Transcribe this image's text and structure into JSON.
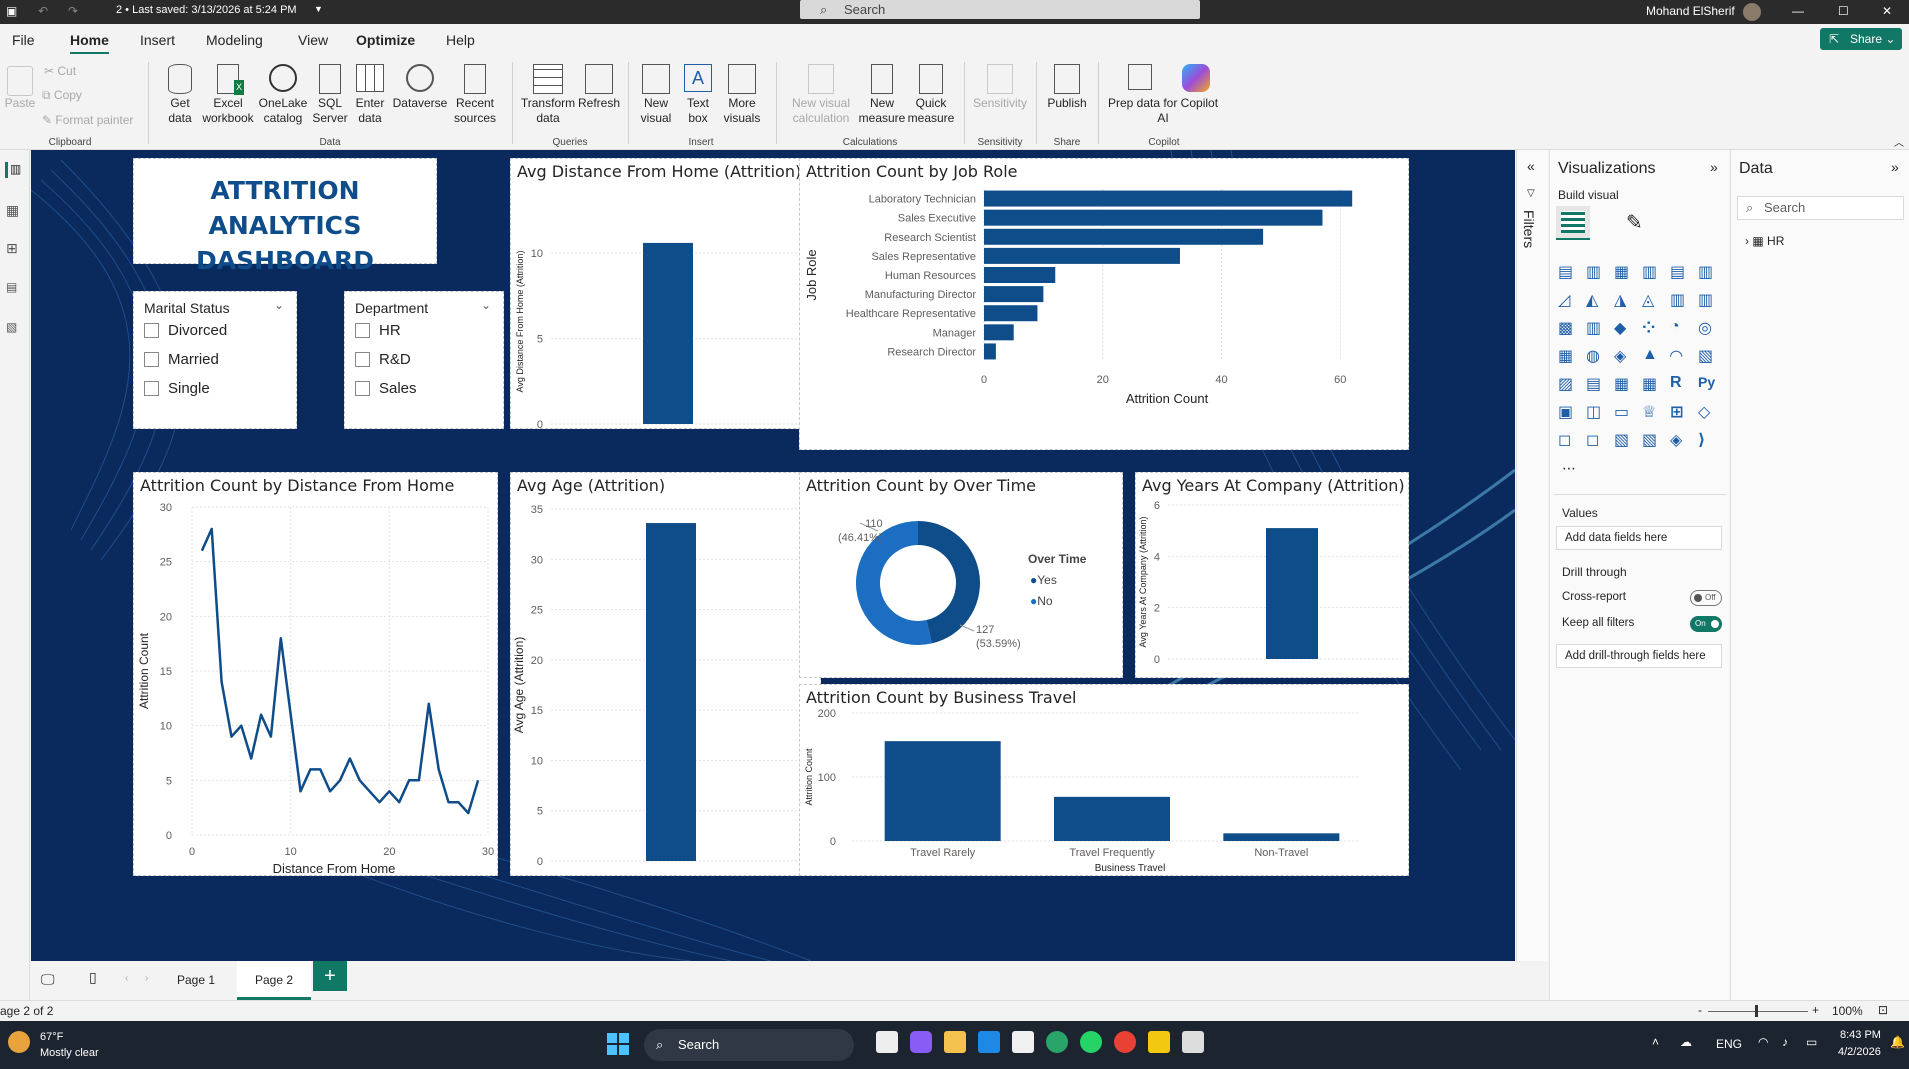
{
  "titlebar": {
    "doc_title": "2 • Last saved: 3/13/2026 at 5:24 PM",
    "search_placeholder": "Search",
    "user_name": "Mohand ElSherif"
  },
  "menu": {
    "file": "File",
    "home": "Home",
    "insert": "Insert",
    "modeling": "Modeling",
    "view": "View",
    "optimize": "Optimize",
    "help": "Help",
    "share": "Share"
  },
  "ribbon": {
    "paste": "Paste",
    "cut": "Cut",
    "copy": "Copy",
    "format_painter": "Format painter",
    "get_data": "Get data",
    "excel": "Excel workbook",
    "onelake": "OneLake catalog",
    "sql": "SQL Server",
    "enter_data": "Enter data",
    "dataverse": "Dataverse",
    "recent": "Recent sources",
    "transform": "Transform data",
    "refresh": "Refresh",
    "new_visual": "New visual",
    "text_box": "Text box",
    "more_visuals": "More visuals",
    "new_visual_calc": "New visual calculation",
    "new_measure": "New measure",
    "quick_measure": "Quick measure",
    "sensitivity": "Sensitivity",
    "publish": "Publish",
    "prep_copilot": "Prep data for Copilot AI",
    "groups": {
      "clipboard": "Clipboard",
      "data": "Data",
      "queries": "Queries",
      "insert": "Insert",
      "calculations": "Calculations",
      "sensitivity": "Sensitivity",
      "share": "Share",
      "copilot": "Copilot"
    }
  },
  "dashboard": {
    "title_line1": "ATTRITION ANALYTICS",
    "title_line2": "DASHBOARD",
    "slicer_marital": {
      "title": "Marital Status",
      "options": [
        "Divorced",
        "Married",
        "Single"
      ]
    },
    "slicer_dept": {
      "title": "Department",
      "options": [
        "HR",
        "R&D",
        "Sales"
      ]
    }
  },
  "visuals": {
    "avg_distance": {
      "title": "Avg Distance From Home (Attrition)",
      "ylabel": "Avg Distance From Home (Attrition)",
      "ticks": [
        "10",
        "5",
        "0"
      ]
    },
    "job_role": {
      "title": "Attrition Count by Job Role",
      "xlabel": "Attrition Count",
      "ylabel": "Job Role",
      "xticks": [
        "0",
        "20",
        "40",
        "60"
      ]
    },
    "distance_line": {
      "title": "Attrition Count by Distance From Home",
      "xlabel": "Distance From Home",
      "ylabel": "Attrition Count",
      "yticks": [
        "30",
        "25",
        "20",
        "15",
        "10",
        "5",
        "0"
      ],
      "xticks": [
        "0",
        "10",
        "20",
        "30"
      ]
    },
    "avg_age": {
      "title": "Avg Age (Attrition)",
      "ylabel": "Avg Age (Attrition)",
      "yticks": [
        "35",
        "30",
        "25",
        "20",
        "15",
        "10",
        "5",
        "0"
      ]
    },
    "overtime": {
      "title": "Attrition Count by Over Time",
      "legend_title": "Over Time",
      "legend": [
        "Yes",
        "No"
      ],
      "label_yes_count": "110",
      "label_yes_pct": "(46.41%)",
      "label_no_count": "127",
      "label_no_pct": "(53.59%)"
    },
    "avg_years": {
      "title": "Avg Years At Company (Attrition)",
      "ylabel": "Avg Years At Company (Attrition)",
      "yticks": [
        "6",
        "4",
        "2",
        "0"
      ]
    },
    "business_travel": {
      "title": "Attrition Count by Business Travel",
      "xlabel": "Business Travel",
      "ylabel": "Attrition Count",
      "yticks": [
        "200",
        "100",
        "0"
      ]
    }
  },
  "chart_data": [
    {
      "type": "bar",
      "categories": [
        ""
      ],
      "values": [
        10.6
      ],
      "title": "Avg Distance From Home (Attrition)",
      "ylabel": "Avg Distance From Home (Attrition)",
      "ylim": [
        0,
        12
      ]
    },
    {
      "type": "bar",
      "orientation": "horizontal",
      "categories": [
        "Laboratory Technician",
        "Sales Executive",
        "Research Scientist",
        "Sales Representative",
        "Human Resources",
        "Manufacturing Director",
        "Healthcare Representative",
        "Manager",
        "Research Director"
      ],
      "values": [
        62,
        57,
        47,
        33,
        12,
        10,
        9,
        5,
        2
      ],
      "title": "Attrition Count by Job Role",
      "xlabel": "Attrition Count",
      "ylabel": "Job Role",
      "xlim": [
        0,
        65
      ]
    },
    {
      "type": "line",
      "x": [
        1,
        2,
        3,
        4,
        5,
        6,
        7,
        8,
        9,
        10,
        11,
        12,
        13,
        14,
        15,
        16,
        17,
        18,
        19,
        20,
        21,
        22,
        23,
        24,
        25,
        26,
        27,
        28,
        29
      ],
      "y": [
        26,
        28,
        14,
        9,
        10,
        7,
        11,
        9,
        18,
        11,
        4,
        6,
        6,
        4,
        5,
        7,
        5,
        4,
        3,
        4,
        3,
        5,
        5,
        12,
        6,
        3,
        3,
        2,
        5
      ],
      "title": "Attrition Count by Distance From Home",
      "xlabel": "Distance From Home",
      "ylabel": "Attrition Count",
      "xlim": [
        0,
        30
      ],
      "ylim": [
        0,
        30
      ]
    },
    {
      "type": "bar",
      "categories": [
        ""
      ],
      "values": [
        33.6
      ],
      "title": "Avg Age (Attrition)",
      "ylabel": "Avg Age (Attrition)",
      "ylim": [
        0,
        35
      ]
    },
    {
      "type": "pie",
      "donut": true,
      "categories": [
        "Yes",
        "No"
      ],
      "values": [
        110,
        127
      ],
      "title": "Attrition Count by Over Time",
      "legend_title": "Over Time"
    },
    {
      "type": "bar",
      "categories": [
        ""
      ],
      "values": [
        5.1
      ],
      "title": "Avg Years At Company (Attrition)",
      "ylabel": "Avg Years At Company (Attrition)",
      "ylim": [
        0,
        6
      ]
    },
    {
      "type": "bar",
      "categories": [
        "Travel Rarely",
        "Travel Frequently",
        "Non-Travel"
      ],
      "values": [
        156,
        69,
        12
      ],
      "title": "Attrition Count by Business Travel",
      "xlabel": "Business Travel",
      "ylabel": "Attrition Count",
      "ylim": [
        0,
        200
      ]
    }
  ],
  "colors": {
    "bar": "#0e4c8a",
    "canvas_bg": "#0a2a5e",
    "donut_yes": "#0e4c8a",
    "donut_no": "#1b6ec2",
    "title_text": "#0e4c8a",
    "accent": "#117865"
  },
  "filters_label": "Filters",
  "viz_pane": {
    "title": "Visualizations",
    "build_visual": "Build visual",
    "values": "Values",
    "add_data": "Add data fields here",
    "drill_through": "Drill through",
    "cross_report": "Cross-report",
    "cross_report_state": "Off",
    "keep_filters": "Keep all filters",
    "keep_filters_state": "On",
    "add_drill": "Add drill-through fields here"
  },
  "data_pane": {
    "title": "Data",
    "search_placeholder": "Search",
    "table": "HR"
  },
  "pages": {
    "page1": "Page 1",
    "page2": "Page 2"
  },
  "status": {
    "page": "age 2 of 2",
    "zoom": "100%"
  },
  "taskbar": {
    "temp": "67°F",
    "weather": "Mostly clear",
    "search": "Search",
    "lang": "ENG",
    "time": "8:43 PM",
    "date": "4/2/2026"
  }
}
